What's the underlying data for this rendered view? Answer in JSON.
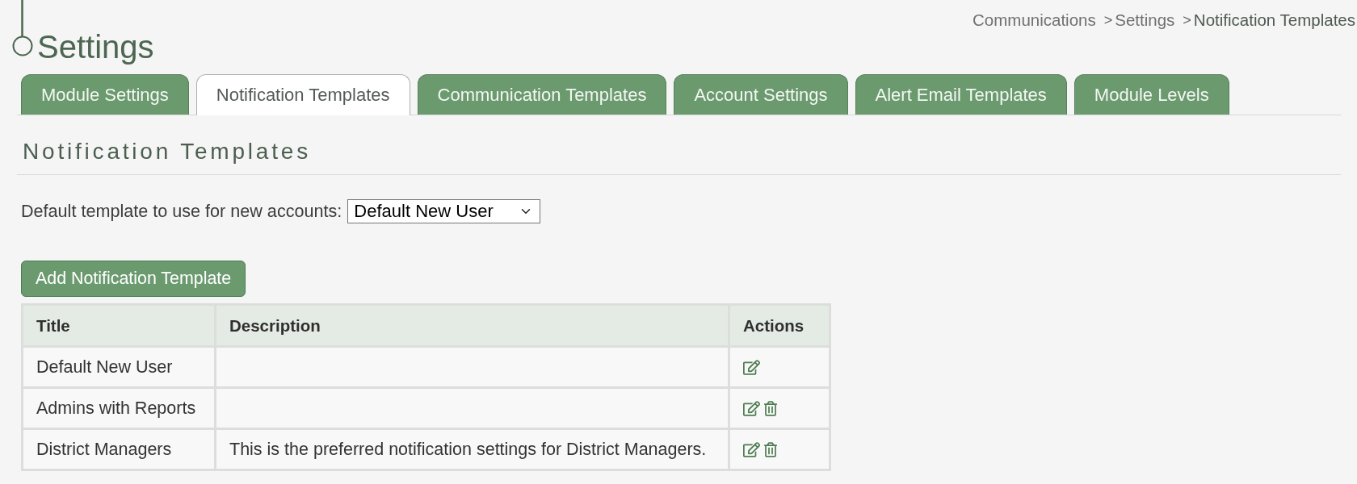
{
  "breadcrumb": {
    "separator": ">",
    "items": [
      {
        "label": "Communications",
        "current": false
      },
      {
        "label": "Settings",
        "current": false
      },
      {
        "label": "Notification Templates",
        "current": true
      }
    ]
  },
  "page_title": "Settings",
  "tabs": [
    {
      "label": "Module Settings",
      "selected": false
    },
    {
      "label": "Notification Templates",
      "selected": true
    },
    {
      "label": "Communication Templates",
      "selected": false
    },
    {
      "label": "Account Settings",
      "selected": false
    },
    {
      "label": "Alert Email Templates",
      "selected": false
    },
    {
      "label": "Module Levels",
      "selected": false
    }
  ],
  "section": {
    "heading": "Notification Templates",
    "default_template": {
      "label": "Default template to use for new accounts:",
      "value": "Default New User"
    },
    "add_button": "Add Notification Template"
  },
  "table": {
    "columns": [
      "Title",
      "Description",
      "Actions"
    ],
    "rows": [
      {
        "title": "Default New User",
        "deletable": false
      },
      {
        "title": "Admins with Reports",
        "deletable": true
      },
      {
        "title": "District Managers",
        "description": "This is the preferred notification settings for District Managers.",
        "deletable": true
      }
    ]
  }
}
